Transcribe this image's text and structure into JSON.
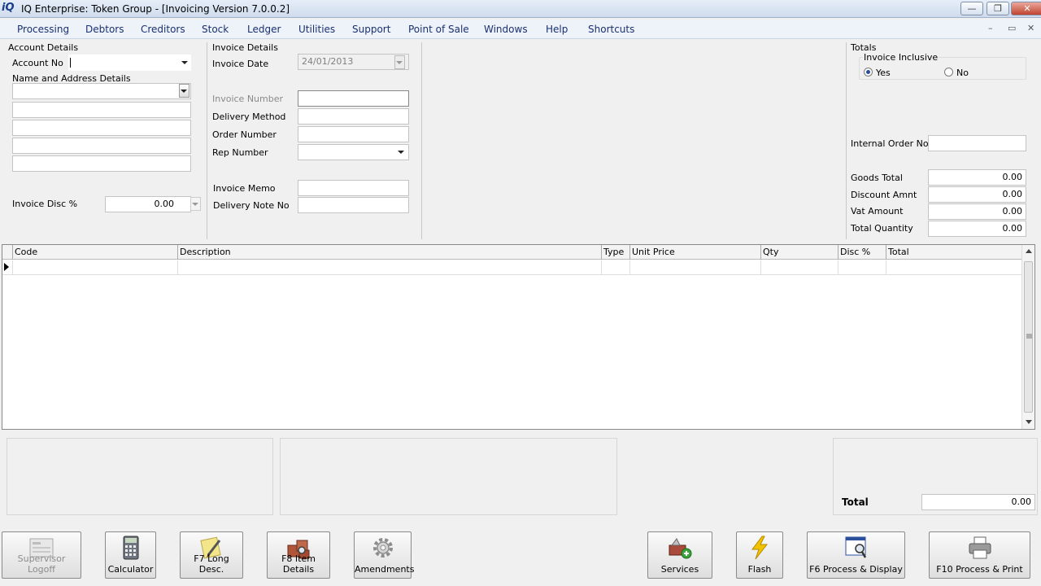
{
  "window": {
    "logo": "iQ",
    "title": "IQ Enterprise: Token Group - [Invoicing Version 7.0.0.2]",
    "minimize": "—",
    "restore": "❐",
    "close": "✕"
  },
  "menu": [
    "Processing",
    "Debtors",
    "Creditors",
    "Stock",
    "Ledger",
    "Utilities",
    "Support",
    "Point of Sale",
    "Windows",
    "Help",
    "Shortcuts"
  ],
  "mdi_controls": {
    "min": "–",
    "restore": "▭",
    "close": "✕"
  },
  "account_details": {
    "title": "Account Details",
    "account_no_label": "Account No",
    "account_no_value": "",
    "name_address_label": "Name and Address Details",
    "invoice_disc_label": "Invoice Disc %",
    "invoice_disc_value": "0.00"
  },
  "invoice_details": {
    "title": "Invoice Details",
    "invoice_date_label": "Invoice Date",
    "invoice_date_value": "24/01/2013",
    "invoice_number_label": "Invoice Number",
    "delivery_method_label": "Delivery Method",
    "order_number_label": "Order Number",
    "rep_number_label": "Rep Number",
    "invoice_memo_label": "Invoice Memo",
    "delivery_note_label": "Delivery Note No"
  },
  "totals": {
    "title": "Totals",
    "inclusive_title": "Invoice Inclusive",
    "yes_label": "Yes",
    "no_label": "No",
    "inclusive_selected": "Yes",
    "internal_order_label": "Internal Order No",
    "goods_total_label": "Goods Total",
    "goods_total_value": "0.00",
    "discount_label": "Discount Amnt",
    "discount_value": "0.00",
    "vat_label": "Vat Amount",
    "vat_value": "0.00",
    "quantity_label": "Total Quantity",
    "quantity_value": "0.00"
  },
  "grid": {
    "columns": [
      "Code",
      "Description",
      "Type",
      "Unit Price",
      "Qty",
      "Disc %",
      "Total"
    ]
  },
  "summary": {
    "total_label": "Total",
    "total_value": "0.00"
  },
  "toolbar": {
    "supervisor": "Supervisor Logoff",
    "calculator": "Calculator",
    "long_desc": "F7 Long Desc.",
    "item_details": "F8 Item Details",
    "amendments": "Amendments",
    "services": "Services",
    "flash": "Flash",
    "process_display": "F6 Process & Display",
    "process_print": "F10 Process & Print"
  },
  "colors": {
    "title_bar": "#cfdced",
    "menu_text": "#1a3070",
    "close_button": "#c0442f",
    "flash_icon": "#f2c200"
  }
}
